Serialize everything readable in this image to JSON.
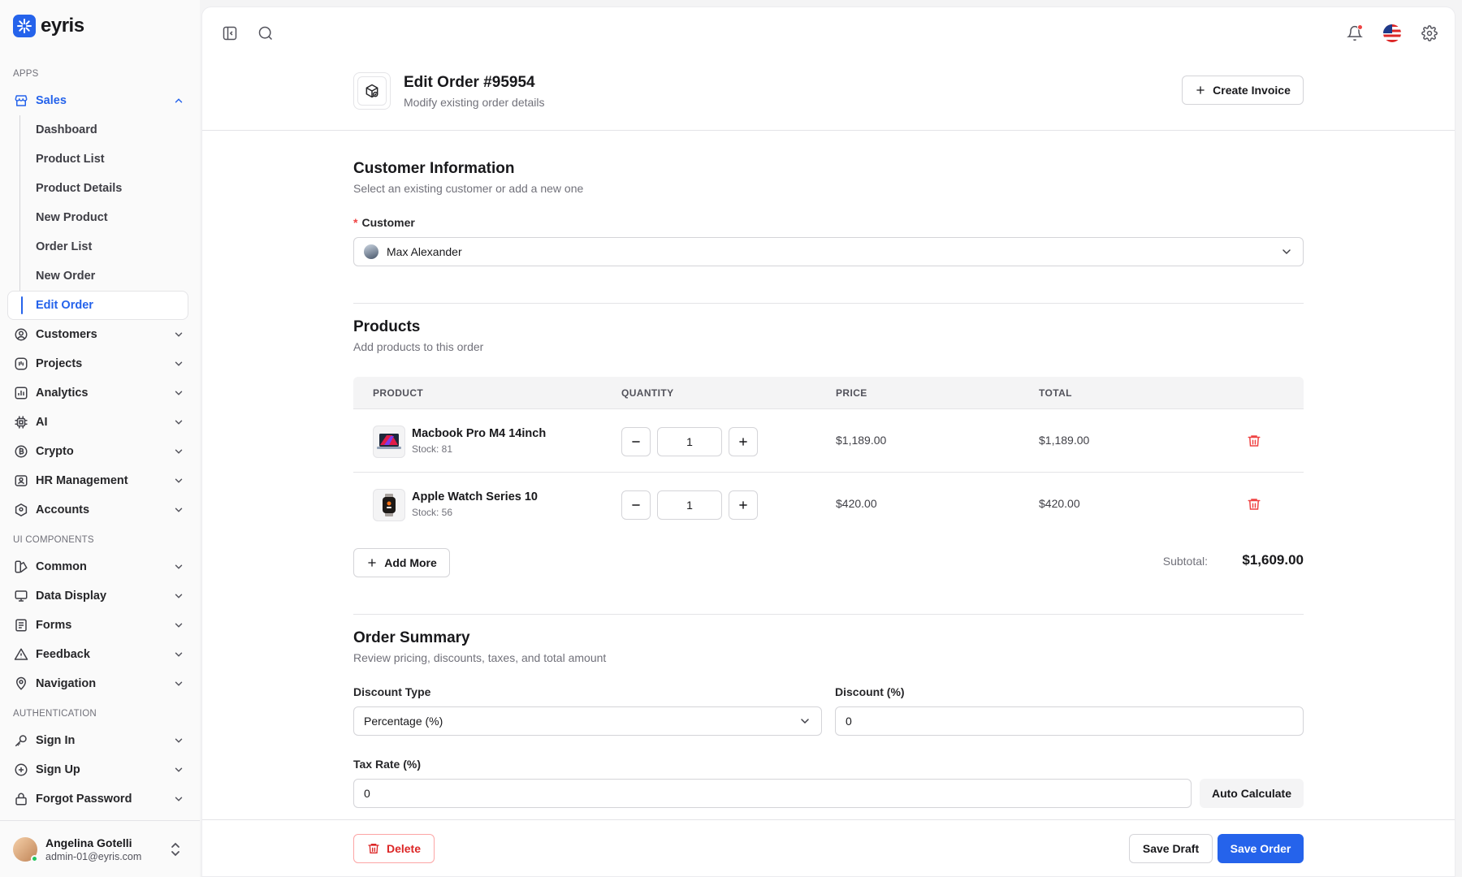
{
  "brand": {
    "name": "eyris",
    "accent": "#2563eb"
  },
  "sidebar": {
    "section_apps": "APPS",
    "sales": {
      "label": "Sales",
      "items": [
        "Dashboard",
        "Product List",
        "Product Details",
        "New Product",
        "Order List",
        "New Order",
        "Edit Order"
      ],
      "current": "Edit Order"
    },
    "apps_items": [
      "Customers",
      "Projects",
      "Analytics",
      "AI",
      "Crypto",
      "HR Management",
      "Accounts"
    ],
    "section_ui": "UI COMPONENTS",
    "ui_items": [
      "Common",
      "Data Display",
      "Forms",
      "Feedback",
      "Navigation"
    ],
    "section_auth": "AUTHENTICATION",
    "auth_items": [
      "Sign In",
      "Sign Up",
      "Forgot Password"
    ],
    "user": {
      "name": "Angelina Gotelli",
      "email": "admin-01@eyris.com"
    }
  },
  "topbar": {
    "icons": [
      "sidebar-toggle-icon",
      "search-icon",
      "bell-icon",
      "us-flag-icon",
      "gear-icon"
    ]
  },
  "header": {
    "title": "Edit Order #95954",
    "subtitle": "Modify existing order details",
    "create_invoice_label": "Create Invoice"
  },
  "customer_section": {
    "title": "Customer Information",
    "subtitle": "Select an existing customer or add a new one",
    "field_label": "Customer",
    "selected_customer": "Max Alexander"
  },
  "products_section": {
    "title": "Products",
    "subtitle": "Add products to this order",
    "columns": [
      "PRODUCT",
      "QUANTITY",
      "PRICE",
      "TOTAL"
    ],
    "rows": [
      {
        "name": "Macbook Pro M4 14inch",
        "stock": "Stock: 81",
        "quantity": "1",
        "price": "$1,189.00",
        "total": "$1,189.00"
      },
      {
        "name": "Apple Watch Series 10",
        "stock": "Stock: 56",
        "quantity": "1",
        "price": "$420.00",
        "total": "$420.00"
      }
    ],
    "add_more_label": "Add More",
    "subtotal_label": "Subtotal:",
    "subtotal_value": "$1,609.00"
  },
  "summary_section": {
    "title": "Order Summary",
    "subtitle": "Review pricing, discounts, taxes, and total amount",
    "discount_type_label": "Discount Type",
    "discount_type_value": "Percentage (%)",
    "discount_label": "Discount (%)",
    "discount_value": "0",
    "tax_label": "Tax Rate (%)",
    "tax_value": "0",
    "auto_calc_label": "Auto Calculate"
  },
  "footer": {
    "delete_label": "Delete",
    "save_draft_label": "Save Draft",
    "save_order_label": "Save Order"
  }
}
